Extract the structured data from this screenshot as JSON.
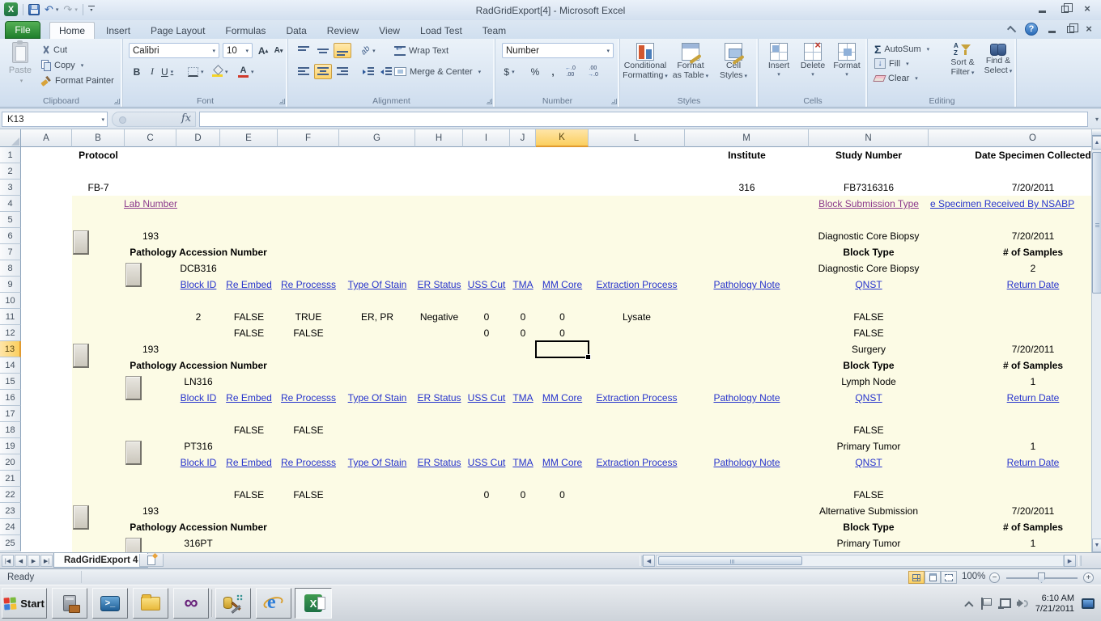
{
  "window": {
    "title": "RadGridExport[4]  -  Microsoft Excel"
  },
  "ribbon": {
    "tabs": [
      "File",
      "Home",
      "Insert",
      "Page Layout",
      "Formulas",
      "Data",
      "Review",
      "View",
      "Load Test",
      "Team"
    ],
    "active_tab": "Home",
    "clipboard": {
      "title": "Clipboard",
      "paste": "Paste",
      "cut": "Cut",
      "copy": "Copy",
      "format_painter": "Format Painter"
    },
    "font": {
      "title": "Font",
      "name": "Calibri",
      "size": "10",
      "bold": "B",
      "italic": "I",
      "underline": "U",
      "color_letter": "A"
    },
    "alignment": {
      "title": "Alignment",
      "wrap": "Wrap Text",
      "merge": "Merge & Center",
      "orient": "ab"
    },
    "number": {
      "title": "Number",
      "format": "Number",
      "currency": "$",
      "percent": "%",
      "comma": ","
    },
    "styles": {
      "title": "Styles",
      "b1": [
        "Conditional",
        "Formatting"
      ],
      "b2": [
        "Format",
        "as Table"
      ],
      "b3": [
        "Cell",
        "Styles"
      ]
    },
    "cells": {
      "title": "Cells",
      "insert": "Insert",
      "delete": "Delete",
      "format": "Format"
    },
    "editing": {
      "title": "Editing",
      "autosum": "AutoSum",
      "fill": "Fill",
      "clear": "Clear",
      "sort": [
        "Sort &",
        "Filter"
      ],
      "find": [
        "Find &",
        "Select"
      ],
      "az": [
        "A",
        "Z"
      ]
    }
  },
  "formula_bar": {
    "name_box": "K13",
    "fx": "fx",
    "value": ""
  },
  "grid": {
    "columns": [
      "A",
      "B",
      "C",
      "D",
      "E",
      "F",
      "G",
      "H",
      "I",
      "J",
      "K",
      "L",
      "M",
      "N",
      "O"
    ],
    "row_count": 25,
    "selection": {
      "ref": "K13",
      "col": "K",
      "row": 13
    },
    "toggles": [
      {
        "row": 6,
        "col": "B"
      },
      {
        "row": 8,
        "col": "C"
      },
      {
        "row": 13,
        "col": "B"
      },
      {
        "row": 15,
        "col": "C"
      },
      {
        "row": 19,
        "col": "C"
      },
      {
        "row": 23,
        "col": "B"
      },
      {
        "row": 25,
        "col": "C"
      }
    ],
    "cells": [
      {
        "r": 1,
        "c": "B",
        "t": "Protocol",
        "f": "b"
      },
      {
        "r": 1,
        "c": "M",
        "t": "Institute",
        "f": "b"
      },
      {
        "r": 1,
        "c": "N",
        "t": "Study Number",
        "f": "b"
      },
      {
        "r": 1,
        "c": "O",
        "t": "Date Specimen Collected",
        "f": "b"
      },
      {
        "r": 3,
        "c": "B",
        "t": "FB-7"
      },
      {
        "r": 3,
        "c": "M",
        "t": "316"
      },
      {
        "r": 3,
        "c": "N",
        "t": "FB7316316"
      },
      {
        "r": 3,
        "c": "O",
        "t": "7/20/2011"
      },
      {
        "r": 4,
        "c": "C",
        "t": "Lab Number",
        "f": "v"
      },
      {
        "r": 4,
        "c": "N",
        "t": "Block Submission Type",
        "f": "v"
      },
      {
        "r": 4,
        "c": "O",
        "t": "e Specimen Received By NSABP",
        "f": "l",
        "a": "left"
      },
      {
        "r": 6,
        "c": "C",
        "t": "193"
      },
      {
        "r": 6,
        "c": "N",
        "t": "Diagnostic Core Biopsy"
      },
      {
        "r": 6,
        "c": "O",
        "t": "7/20/2011"
      },
      {
        "r": 7,
        "c": "D",
        "t": "Pathology Accession Number",
        "f": "b"
      },
      {
        "r": 7,
        "c": "N",
        "t": "Block Type",
        "f": "b"
      },
      {
        "r": 7,
        "c": "O",
        "t": "# of Samples",
        "f": "b"
      },
      {
        "r": 8,
        "c": "D",
        "t": "DCB316"
      },
      {
        "r": 8,
        "c": "N",
        "t": "Diagnostic Core Biopsy"
      },
      {
        "r": 8,
        "c": "O",
        "t": "2"
      },
      {
        "r": 9,
        "c": "D",
        "t": "Block ID",
        "f": "l"
      },
      {
        "r": 9,
        "c": "E",
        "t": "Re Embed",
        "f": "l"
      },
      {
        "r": 9,
        "c": "F",
        "t": "Re Processs",
        "f": "l"
      },
      {
        "r": 9,
        "c": "G",
        "t": "Type Of Stain",
        "f": "l"
      },
      {
        "r": 9,
        "c": "H",
        "t": "ER Status",
        "f": "l"
      },
      {
        "r": 9,
        "c": "I",
        "t": "USS Cut",
        "f": "l"
      },
      {
        "r": 9,
        "c": "J",
        "t": "TMA",
        "f": "l"
      },
      {
        "r": 9,
        "c": "K",
        "t": "MM Core",
        "f": "l"
      },
      {
        "r": 9,
        "c": "L",
        "t": "Extraction Process",
        "f": "l"
      },
      {
        "r": 9,
        "c": "M",
        "t": "Pathology Note",
        "f": "l"
      },
      {
        "r": 9,
        "c": "N",
        "t": "QNST",
        "f": "l"
      },
      {
        "r": 9,
        "c": "O",
        "t": "Return Date",
        "f": "l"
      },
      {
        "r": 11,
        "c": "D",
        "t": "2"
      },
      {
        "r": 11,
        "c": "E",
        "t": "FALSE"
      },
      {
        "r": 11,
        "c": "F",
        "t": "TRUE"
      },
      {
        "r": 11,
        "c": "G",
        "t": "ER, PR"
      },
      {
        "r": 11,
        "c": "H",
        "t": "Negative"
      },
      {
        "r": 11,
        "c": "I",
        "t": "0"
      },
      {
        "r": 11,
        "c": "J",
        "t": "0"
      },
      {
        "r": 11,
        "c": "K",
        "t": "0"
      },
      {
        "r": 11,
        "c": "L",
        "t": "Lysate"
      },
      {
        "r": 11,
        "c": "N",
        "t": "FALSE"
      },
      {
        "r": 12,
        "c": "E",
        "t": "FALSE"
      },
      {
        "r": 12,
        "c": "F",
        "t": "FALSE"
      },
      {
        "r": 12,
        "c": "I",
        "t": "0"
      },
      {
        "r": 12,
        "c": "J",
        "t": "0"
      },
      {
        "r": 12,
        "c": "K",
        "t": "0"
      },
      {
        "r": 12,
        "c": "N",
        "t": "FALSE"
      },
      {
        "r": 13,
        "c": "C",
        "t": "193"
      },
      {
        "r": 13,
        "c": "N",
        "t": "Surgery"
      },
      {
        "r": 13,
        "c": "O",
        "t": "7/20/2011"
      },
      {
        "r": 14,
        "c": "D",
        "t": "Pathology Accession Number",
        "f": "b"
      },
      {
        "r": 14,
        "c": "N",
        "t": "Block Type",
        "f": "b"
      },
      {
        "r": 14,
        "c": "O",
        "t": "# of Samples",
        "f": "b"
      },
      {
        "r": 15,
        "c": "D",
        "t": "LN316"
      },
      {
        "r": 15,
        "c": "N",
        "t": "Lymph Node"
      },
      {
        "r": 15,
        "c": "O",
        "t": "1"
      },
      {
        "r": 16,
        "c": "D",
        "t": "Block ID",
        "f": "l"
      },
      {
        "r": 16,
        "c": "E",
        "t": "Re Embed",
        "f": "l"
      },
      {
        "r": 16,
        "c": "F",
        "t": "Re Processs",
        "f": "l"
      },
      {
        "r": 16,
        "c": "G",
        "t": "Type Of Stain",
        "f": "l"
      },
      {
        "r": 16,
        "c": "H",
        "t": "ER Status",
        "f": "l"
      },
      {
        "r": 16,
        "c": "I",
        "t": "USS Cut",
        "f": "l"
      },
      {
        "r": 16,
        "c": "J",
        "t": "TMA",
        "f": "l"
      },
      {
        "r": 16,
        "c": "K",
        "t": "MM Core",
        "f": "l"
      },
      {
        "r": 16,
        "c": "L",
        "t": "Extraction Process",
        "f": "l"
      },
      {
        "r": 16,
        "c": "M",
        "t": "Pathology Note",
        "f": "l"
      },
      {
        "r": 16,
        "c": "N",
        "t": "QNST",
        "f": "l"
      },
      {
        "r": 16,
        "c": "O",
        "t": "Return Date",
        "f": "l"
      },
      {
        "r": 18,
        "c": "E",
        "t": "FALSE"
      },
      {
        "r": 18,
        "c": "F",
        "t": "FALSE"
      },
      {
        "r": 18,
        "c": "N",
        "t": "FALSE"
      },
      {
        "r": 19,
        "c": "D",
        "t": "PT316"
      },
      {
        "r": 19,
        "c": "N",
        "t": "Primary Tumor"
      },
      {
        "r": 19,
        "c": "O",
        "t": "1"
      },
      {
        "r": 20,
        "c": "D",
        "t": "Block ID",
        "f": "l"
      },
      {
        "r": 20,
        "c": "E",
        "t": "Re Embed",
        "f": "l"
      },
      {
        "r": 20,
        "c": "F",
        "t": "Re Processs",
        "f": "l"
      },
      {
        "r": 20,
        "c": "G",
        "t": "Type Of Stain",
        "f": "l"
      },
      {
        "r": 20,
        "c": "H",
        "t": "ER Status",
        "f": "l"
      },
      {
        "r": 20,
        "c": "I",
        "t": "USS Cut",
        "f": "l"
      },
      {
        "r": 20,
        "c": "J",
        "t": "TMA",
        "f": "l"
      },
      {
        "r": 20,
        "c": "K",
        "t": "MM Core",
        "f": "l"
      },
      {
        "r": 20,
        "c": "L",
        "t": "Extraction Process",
        "f": "l"
      },
      {
        "r": 20,
        "c": "M",
        "t": "Pathology Note",
        "f": "l"
      },
      {
        "r": 20,
        "c": "N",
        "t": "QNST",
        "f": "l"
      },
      {
        "r": 20,
        "c": "O",
        "t": "Return Date",
        "f": "l"
      },
      {
        "r": 22,
        "c": "E",
        "t": "FALSE"
      },
      {
        "r": 22,
        "c": "F",
        "t": "FALSE"
      },
      {
        "r": 22,
        "c": "I",
        "t": "0"
      },
      {
        "r": 22,
        "c": "J",
        "t": "0"
      },
      {
        "r": 22,
        "c": "K",
        "t": "0"
      },
      {
        "r": 22,
        "c": "N",
        "t": "FALSE"
      },
      {
        "r": 23,
        "c": "C",
        "t": "193"
      },
      {
        "r": 23,
        "c": "N",
        "t": "Alternative Submission"
      },
      {
        "r": 23,
        "c": "O",
        "t": "7/20/2011"
      },
      {
        "r": 24,
        "c": "D",
        "t": "Pathology Accession Number",
        "f": "b"
      },
      {
        "r": 24,
        "c": "N",
        "t": "Block Type",
        "f": "b"
      },
      {
        "r": 24,
        "c": "O",
        "t": "# of Samples",
        "f": "b"
      },
      {
        "r": 25,
        "c": "D",
        "t": "316PT"
      },
      {
        "r": 25,
        "c": "N",
        "t": "Primary Tumor"
      },
      {
        "r": 25,
        "c": "O",
        "t": "1"
      }
    ]
  },
  "sheet_bar": {
    "tab": "RadGridExport 4"
  },
  "status_bar": {
    "mode": "Ready",
    "zoom": "100%"
  },
  "taskbar": {
    "start": "Start",
    "buttons": [
      "server-manager",
      "powershell",
      "windows-explorer",
      "visual-studio",
      "sql-server-tools",
      "internet-explorer",
      "excel"
    ],
    "active_button": "excel",
    "clock": {
      "time": "6:10 AM",
      "date": "7/21/2011"
    }
  }
}
